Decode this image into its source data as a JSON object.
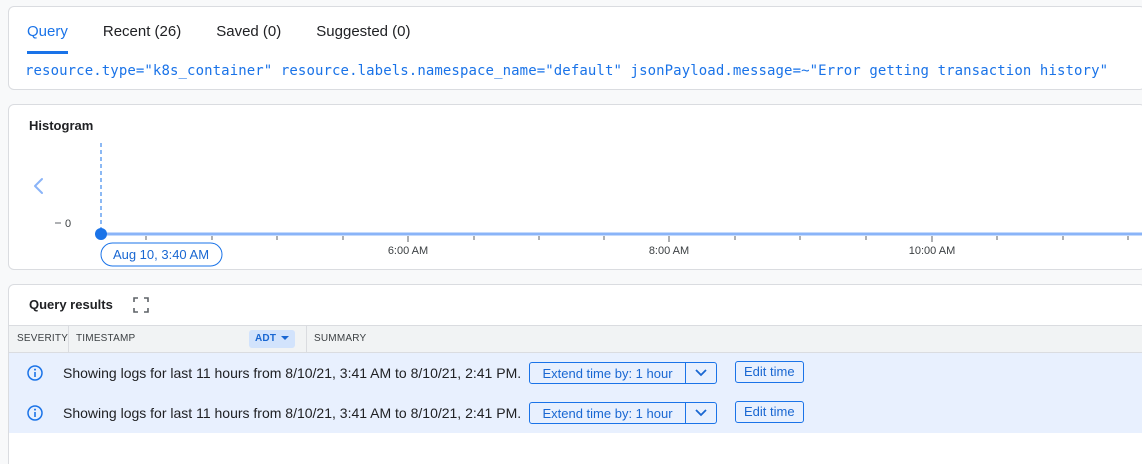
{
  "tabs": [
    {
      "label": "Query"
    },
    {
      "label": "Recent (26)"
    },
    {
      "label": "Saved (0)"
    },
    {
      "label": "Suggested (0)"
    }
  ],
  "query": "resource.type=\"k8s_container\" resource.labels.namespace_name=\"default\" jsonPayload.message=~\"Error getting transaction history\"",
  "histogram": {
    "title": "Histogram",
    "y_tick": "0",
    "cursor_label": "Aug 10, 3:40 AM",
    "x_ticks": [
      "6:00 AM",
      "8:00 AM",
      "10:00 AM"
    ],
    "colors": {
      "accent": "#1a73e8"
    }
  },
  "chart_data": {
    "type": "bar",
    "title": "Histogram",
    "x": [
      "Aug 10, 3:40 AM",
      "6:00 AM",
      "8:00 AM",
      "10:00 AM"
    ],
    "values": [
      0,
      0,
      0,
      0
    ],
    "yticks": [
      "0"
    ],
    "grid": false
  },
  "results": {
    "title": "Query results",
    "columns": {
      "severity": "SEVERITY",
      "timestamp": "TIMESTAMP",
      "tz": "ADT",
      "summary": "SUMMARY"
    },
    "rows": [
      {
        "text": "Showing logs for last 11 hours from 8/10/21, 3:41 AM to 8/10/21, 2:41 PM.",
        "extend": "Extend time by: 1 hour",
        "edit": "Edit time"
      },
      {
        "text": "Showing logs for last 11 hours from 8/10/21, 3:41 AM to 8/10/21, 2:41 PM.",
        "extend": "Extend time by: 1 hour",
        "edit": "Edit time"
      }
    ]
  }
}
